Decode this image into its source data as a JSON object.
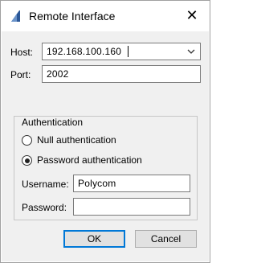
{
  "window": {
    "title": "Remote Interface",
    "close_icon": "close-icon",
    "app_icon": "app-logo-icon"
  },
  "host": {
    "label": "Host:",
    "value": "192.168.100.160",
    "dropdown_icon": "chevron-down-icon"
  },
  "port": {
    "label": "Port:",
    "value": "2002"
  },
  "authentication": {
    "group_label": "Authentication",
    "options": [
      {
        "label": "Null authentication",
        "selected": false
      },
      {
        "label": "Password authentication",
        "selected": true
      }
    ],
    "username": {
      "label": "Username:",
      "value": "Polycom"
    },
    "password": {
      "label": "Password:",
      "value": ""
    }
  },
  "buttons": {
    "ok": "OK",
    "cancel": "Cancel"
  },
  "colors": {
    "accent": "#0078d7",
    "dialog_bg": "#f0f0f0",
    "app_icon": "#2b5797"
  }
}
